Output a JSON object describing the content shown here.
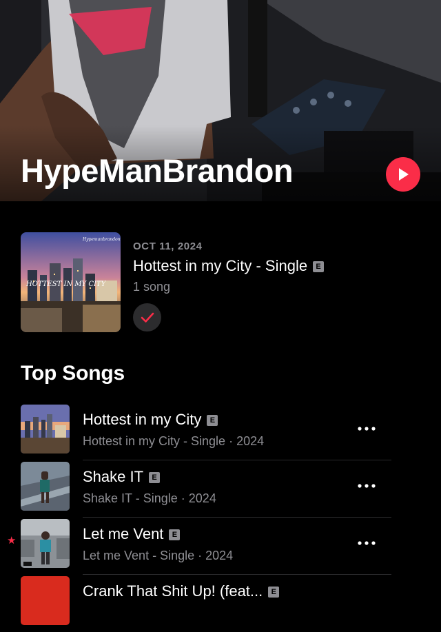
{
  "artist": {
    "name": "HypeManBrandon"
  },
  "release": {
    "date": "OCT 11, 2024",
    "title": "Hottest in my City - Single",
    "explicit": "E",
    "count": "1 song",
    "art_caption": "HOTTEST IN MY CITY",
    "art_brand": "Hypemanbrandon"
  },
  "top_songs": {
    "title": "Top Songs",
    "items": [
      {
        "title": "Hottest in my City",
        "explicit": "E",
        "album": "Hottest in my City - Single",
        "sep": "·",
        "year": "2024"
      },
      {
        "title": "Shake IT",
        "explicit": "E",
        "album": "Shake IT - Single",
        "sep": "·",
        "year": "2024"
      },
      {
        "title": "Let me Vent",
        "explicit": "E",
        "album": "Let me Vent - Single",
        "sep": "·",
        "year": "2024"
      }
    ],
    "partial_title": "Crank That Shit Up! (feat..."
  },
  "colors": {
    "accent": "#fa2d48",
    "secondary_text": "#8e8e93",
    "background": "#000000"
  },
  "icons": {
    "play": "play-icon",
    "check": "checkmark-icon",
    "more": "ellipsis-icon",
    "favorite": "star-icon"
  }
}
